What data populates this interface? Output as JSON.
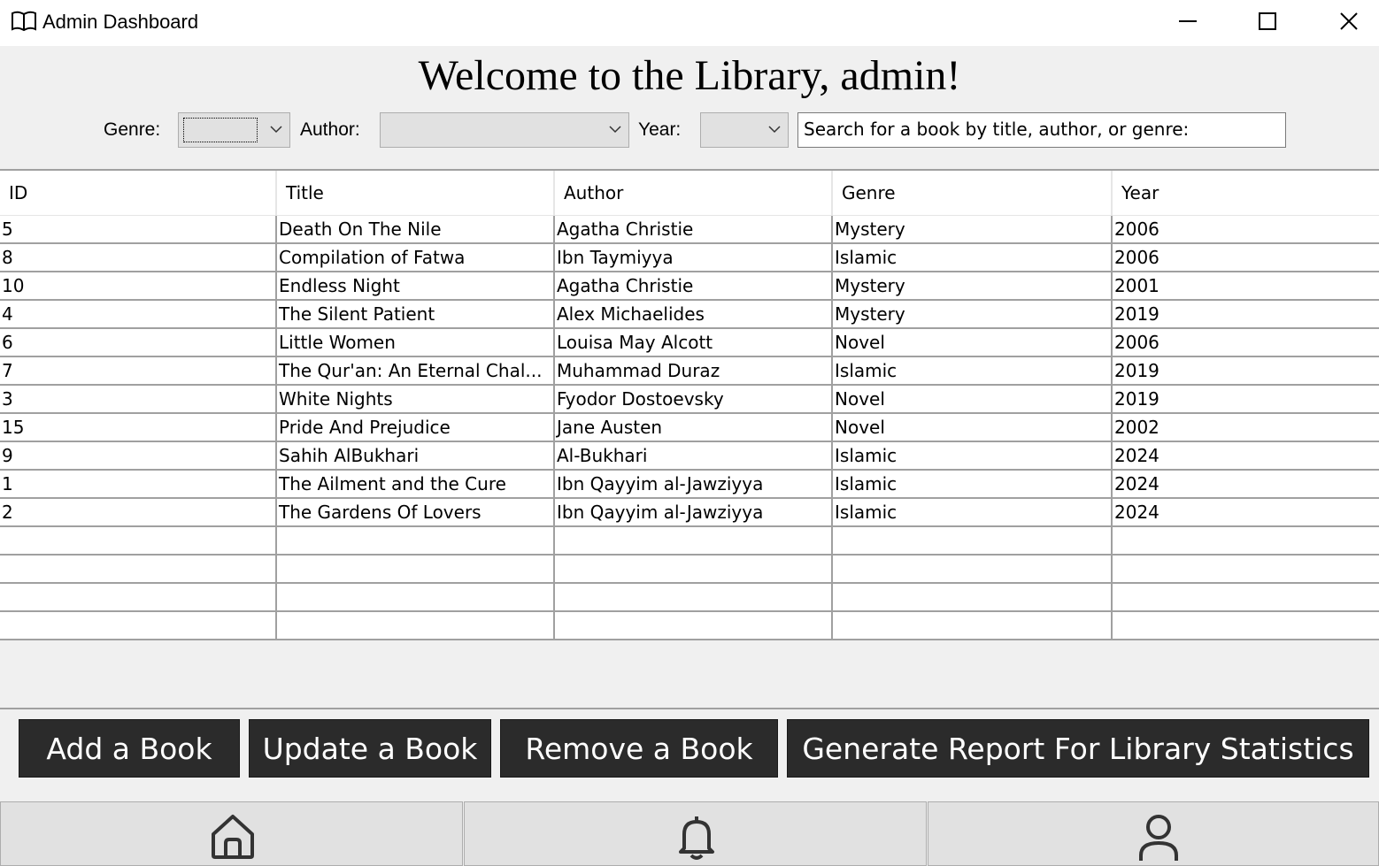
{
  "window": {
    "title": "Admin Dashboard"
  },
  "heading": "Welcome to the Library, admin!",
  "filters": {
    "genre_label": "Genre:",
    "genre_value": "",
    "author_label": "Author:",
    "author_value": "",
    "year_label": "Year:",
    "year_value": "",
    "search_value": "Search for a book by title, author, or genre:"
  },
  "table": {
    "columns": [
      "ID",
      "Title",
      "Author",
      "Genre",
      "Year"
    ],
    "rows": [
      [
        "5",
        "Death On The Nile",
        "Agatha Christie",
        "Mystery",
        "2006"
      ],
      [
        "8",
        "Compilation of Fatwa",
        "Ibn Taymiyya",
        "Islamic",
        "2006"
      ],
      [
        "10",
        "Endless Night",
        "Agatha Christie",
        "Mystery",
        "2001"
      ],
      [
        "4",
        "The Silent Patient",
        "Alex Michaelides",
        "Mystery",
        "2019"
      ],
      [
        "6",
        "Little Women",
        "Louisa May Alcott",
        "Novel",
        "2006"
      ],
      [
        "7",
        "The Qur'an: An Eternal Chal...",
        "Muhammad Duraz",
        "Islamic",
        "2019"
      ],
      [
        "3",
        "White Nights",
        "Fyodor Dostoevsky",
        "Novel",
        "2019"
      ],
      [
        "15",
        "Pride And Prejudice",
        "Jane Austen",
        "Novel",
        "2002"
      ],
      [
        "9",
        "Sahih AlBukhari",
        "Al-Bukhari",
        "Islamic",
        "2024"
      ],
      [
        "1",
        "The Ailment and the Cure",
        "Ibn Qayyim al-Jawziyya",
        "Islamic",
        "2024"
      ],
      [
        "2",
        "The Gardens Of Lovers",
        "Ibn Qayyim al-Jawziyya",
        "Islamic",
        "2024"
      ]
    ]
  },
  "actions": {
    "add": "Add a Book",
    "update": "Update a Book",
    "remove": "Remove a Book",
    "report": "Generate Report For Library Statistics"
  },
  "nav": {
    "items": [
      {
        "icon": "home-icon"
      },
      {
        "icon": "bell-icon"
      },
      {
        "icon": "user-icon"
      }
    ]
  }
}
